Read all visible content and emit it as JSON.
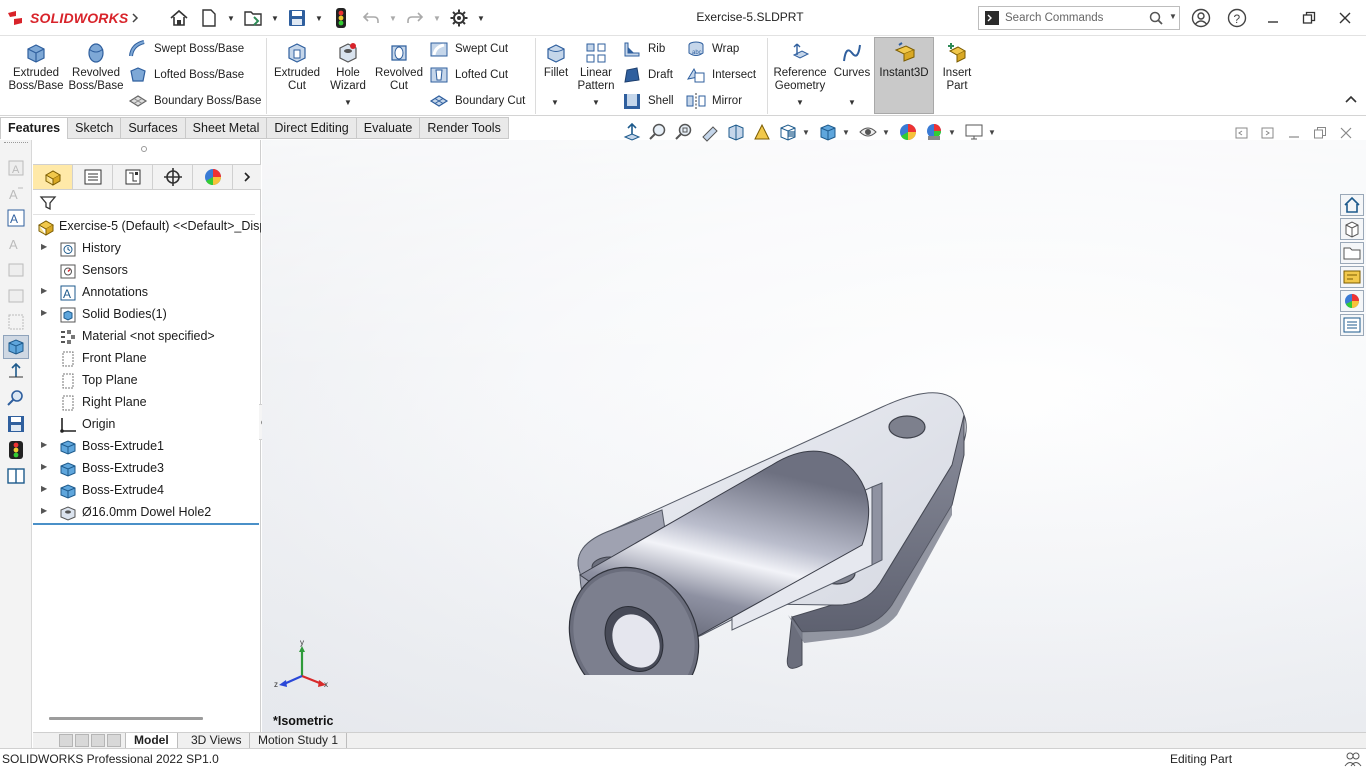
{
  "app": {
    "brand": "SOLIDWORKS",
    "document_title": "Exercise-5.SLDPRT",
    "search_placeholder": "Search Commands"
  },
  "ribbon": {
    "extruded_boss": "Extruded Boss/Base",
    "revolved_boss": "Revolved Boss/Base",
    "swept_boss": "Swept Boss/Base",
    "lofted_boss": "Lofted Boss/Base",
    "boundary_boss": "Boundary Boss/Base",
    "extruded_cut": "Extruded Cut",
    "hole_wizard": "Hole Wizard",
    "revolved_cut": "Revolved Cut",
    "swept_cut": "Swept Cut",
    "lofted_cut": "Lofted Cut",
    "boundary_cut": "Boundary Cut",
    "fillet": "Fillet",
    "linear_pattern": "Linear Pattern",
    "rib": "Rib",
    "draft": "Draft",
    "shell": "Shell",
    "wrap": "Wrap",
    "intersect": "Intersect",
    "mirror": "Mirror",
    "reference_geometry": "Reference Geometry",
    "curves": "Curves",
    "instant3d": "Instant3D",
    "insert_part": "Insert Part"
  },
  "tabs": [
    "Features",
    "Sketch",
    "Surfaces",
    "Sheet Metal",
    "Direct Editing",
    "Evaluate",
    "Render Tools"
  ],
  "tree": {
    "root": "Exercise-5 (Default) <<Default>_Displ",
    "items": [
      {
        "label": "History",
        "expandable": true
      },
      {
        "label": "Sensors",
        "expandable": false
      },
      {
        "label": "Annotations",
        "expandable": true
      },
      {
        "label": "Solid Bodies(1)",
        "expandable": true
      },
      {
        "label": "Material <not specified>",
        "expandable": false
      },
      {
        "label": "Front Plane",
        "expandable": false
      },
      {
        "label": "Top Plane",
        "expandable": false
      },
      {
        "label": "Right Plane",
        "expandable": false
      },
      {
        "label": "Origin",
        "expandable": false
      },
      {
        "label": "Boss-Extrude1",
        "expandable": true
      },
      {
        "label": "Boss-Extrude3",
        "expandable": true
      },
      {
        "label": "Boss-Extrude4",
        "expandable": true
      },
      {
        "label": "Ø16.0mm Dowel Hole2",
        "expandable": true
      }
    ]
  },
  "viewport": {
    "view_name": "*Isometric",
    "triad": {
      "x": "x",
      "y": "y",
      "z": "z"
    }
  },
  "bottom_tabs": [
    "Model",
    "3D Views",
    "Motion Study 1"
  ],
  "status": {
    "left": "SOLIDWORKS Professional 2022 SP1.0",
    "right": "Editing Part"
  },
  "colors": {
    "brand_red": "#d8232a",
    "instant3d_active": "#c9c9c9",
    "fm_active_tab": "#ffe9a8"
  }
}
